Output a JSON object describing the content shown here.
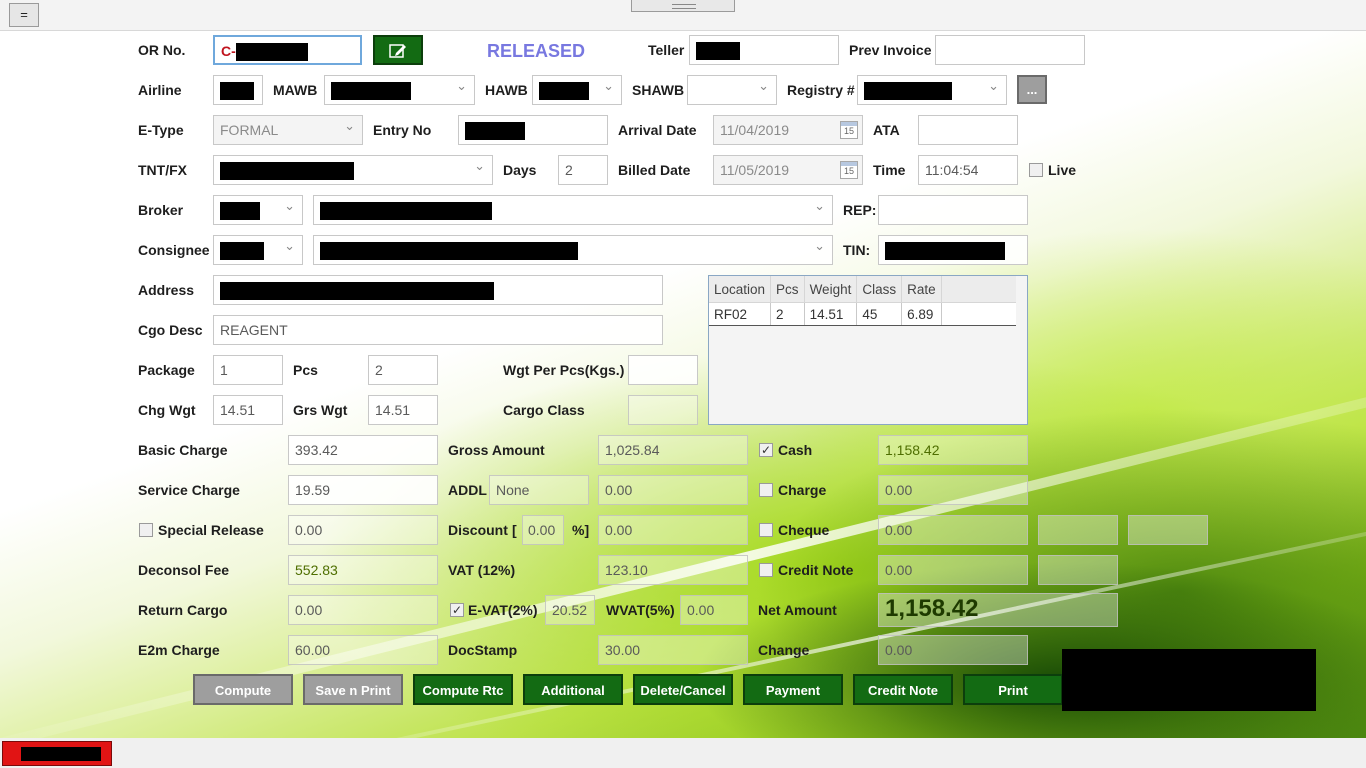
{
  "top": {
    "menu_label": "="
  },
  "status": {
    "released": "RELEASED"
  },
  "labels": {
    "or_no": "OR No.",
    "teller": "Teller",
    "prev_invoice": "Prev Invoice",
    "airline": "Airline",
    "mawb": "MAWB",
    "hawb": "HAWB",
    "shawb": "SHAWB",
    "registry": "Registry #",
    "etype": "E-Type",
    "entry_no": "Entry No",
    "arrival_date": "Arrival Date",
    "ata": "ATA",
    "tnt_fx": "TNT/FX",
    "days": "Days",
    "billed_date": "Billed Date",
    "time": "Time",
    "live": "Live",
    "broker": "Broker",
    "rep": "REP:",
    "consignee": "Consignee",
    "tin": "TIN:",
    "address": "Address",
    "cgo_desc": "Cgo Desc",
    "package": "Package",
    "pcs": "Pcs",
    "wgt_per_pcs": "Wgt Per Pcs(Kgs.)",
    "chg_wgt": "Chg Wgt",
    "grs_wgt": "Grs Wgt",
    "cargo_class": "Cargo Class",
    "basic_charge": "Basic Charge",
    "gross_amount": "Gross Amount",
    "cash": "Cash",
    "service_charge": "Service Charge",
    "addl": "ADDL",
    "charge": "Charge",
    "special_release": "Special Release",
    "discount": "Discount",
    "discount_open": "[",
    "discount_close": "%]",
    "cheque": "Cheque",
    "deconsol_fee": "Deconsol Fee",
    "vat": "VAT (12%)",
    "credit_note": "Credit Note",
    "return_cargo": "Return Cargo",
    "evat": "E-VAT(2%)",
    "wvat": "WVAT(5%)",
    "net_amount": "Net Amount",
    "e2m_charge": "E2m Charge",
    "docstamp": "DocStamp",
    "change": "Change"
  },
  "values": {
    "or_prefix": "C-",
    "etype": "FORMAL",
    "arrival_date": "11/04/2019",
    "days": "2",
    "billed_date": "11/05/2019",
    "time": "11:04:54",
    "cgo_desc": "REAGENT",
    "package": "1",
    "pcs": "2",
    "chg_wgt": "14.51",
    "grs_wgt": "14.51",
    "basic_charge": "393.42",
    "gross_amount": "1,025.84",
    "cash": "1,158.42",
    "service_charge": "19.59",
    "addl_type": "None",
    "addl_amount": "0.00",
    "charge": "0.00",
    "special_release": "0.00",
    "discount_pct": "0.00",
    "discount_amount": "0.00",
    "cheque": "0.00",
    "deconsol_fee": "552.83",
    "vat": "123.10",
    "credit_note": "0.00",
    "return_cargo": "0.00",
    "evat": "20.52",
    "wvat": "0.00",
    "net_amount": "1,158.42",
    "e2m_charge": "60.00",
    "docstamp": "30.00",
    "change": "0.00",
    "calendar_day": "15",
    "registry_btn": "..."
  },
  "checks": {
    "cash_check": "✓",
    "evat_check": "✓"
  },
  "grid": {
    "headers": [
      "Location",
      "Pcs",
      "Weight",
      "Class",
      "Rate"
    ],
    "rows": [
      [
        "RF02",
        "2",
        "14.51",
        "45",
        "6.89"
      ]
    ]
  },
  "buttons": {
    "compute": "Compute",
    "save_print": "Save n Print",
    "compute_rtc": "Compute Rtc",
    "additional": "Additional",
    "delete_cancel": "Delete/Cancel",
    "payment": "Payment",
    "credit_note": "Credit Note",
    "print": "Print"
  },
  "colors": {
    "accent_green": "#136b13",
    "status_blue": "#7878e0",
    "or_red": "#c0141e"
  },
  "icons": {
    "edit": "edit-icon",
    "calendar": "calendar-icon",
    "dropdown": "chevron-down-icon"
  }
}
